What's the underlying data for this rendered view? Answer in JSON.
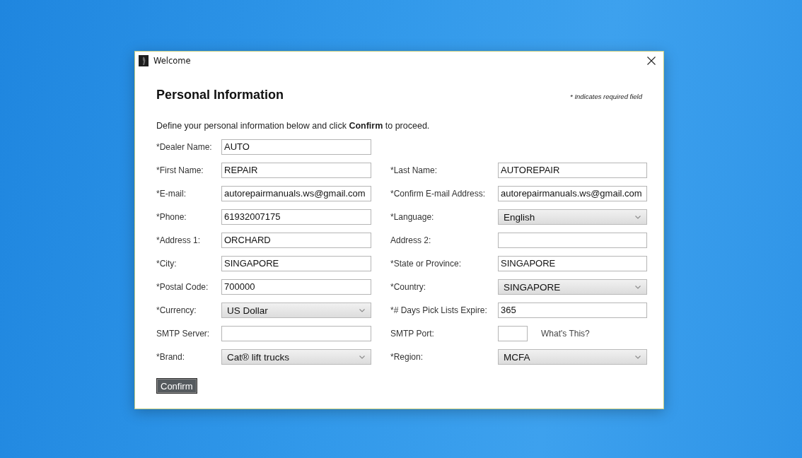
{
  "window": {
    "title": "Welcome"
  },
  "form": {
    "heading": "Personal Information",
    "required_note": "* Indicates required field",
    "instructions": "Define your personal information below and click **Confirm** to proceed.",
    "rows": [
      {
        "left": {
          "label": "*Dealer Name:",
          "kind": "text",
          "value": "AUTO"
        }
      },
      {
        "left": {
          "label": "*First Name:",
          "kind": "text",
          "value": "REPAIR"
        },
        "right": {
          "label": "*Last Name:",
          "kind": "text",
          "value": "AUTOREPAIR"
        }
      },
      {
        "left": {
          "label": "*E-mail:",
          "kind": "text",
          "value": "autorepairmanuals.ws@gmail.com"
        },
        "right": {
          "label": "*Confirm E-mail Address:",
          "kind": "text",
          "value": "autorepairmanuals.ws@gmail.com"
        }
      },
      {
        "left": {
          "label": "*Phone:",
          "kind": "text",
          "value": "61932007175"
        },
        "right": {
          "label": "*Language:",
          "kind": "select",
          "value": "English"
        }
      },
      {
        "left": {
          "label": "*Address 1:",
          "kind": "text",
          "value": "ORCHARD"
        },
        "right": {
          "label": "Address 2:",
          "kind": "text"
        }
      },
      {
        "left": {
          "label": "*City:",
          "kind": "text",
          "value": "SINGAPORE"
        },
        "right": {
          "label": "*State or Province:",
          "kind": "text",
          "value": "SINGAPORE"
        }
      },
      {
        "left": {
          "label": "*Postal Code:",
          "kind": "text",
          "value": "700000"
        },
        "right": {
          "label": "*Country:",
          "kind": "select",
          "value": "SINGAPORE"
        }
      },
      {
        "left": {
          "label": "*Currency:",
          "kind": "select",
          "value": "US Dollar"
        },
        "right": {
          "label": "*# Days Pick Lists Expire:",
          "kind": "text",
          "value": "365"
        }
      },
      {
        "left": {
          "label": "SMTP Server:",
          "kind": "text"
        },
        "right": {
          "label": "SMTP Port:",
          "kind": "short_text",
          "help_link": "What's This?"
        }
      },
      {
        "left": {
          "label": "*Brand:",
          "kind": "select",
          "value": "Cat® lift trucks"
        },
        "right": {
          "label": "*Region:",
          "kind": "select",
          "value": "MCFA"
        }
      }
    ],
    "submit": "Confirm"
  }
}
